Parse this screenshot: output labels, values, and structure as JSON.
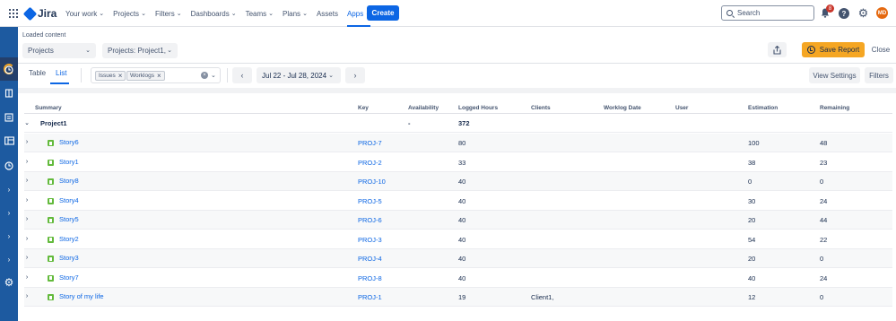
{
  "topnav": {
    "logo_text": "Jira",
    "items": [
      {
        "label": "Your work",
        "chevron": true,
        "active": false
      },
      {
        "label": "Projects",
        "chevron": true,
        "active": false
      },
      {
        "label": "Filters",
        "chevron": true,
        "active": false
      },
      {
        "label": "Dashboards",
        "chevron": true,
        "active": false
      },
      {
        "label": "Teams",
        "chevron": true,
        "active": false
      },
      {
        "label": "Plans",
        "chevron": true,
        "active": false
      },
      {
        "label": "Assets",
        "chevron": false,
        "active": false
      },
      {
        "label": "Apps",
        "chevron": true,
        "active": true
      }
    ],
    "create_label": "Create",
    "search_placeholder": "Search",
    "notification_count": "8",
    "help_label": "?",
    "avatar_initials": "MD"
  },
  "sidebar": {
    "icons": [
      "app-logo-icon",
      "clock-icon",
      "book-icon",
      "list-icon",
      "board-icon",
      "history-icon",
      "chevron-right-icon",
      "chevron-right-icon",
      "chevron-right-icon",
      "chevron-right-icon",
      "gear-icon"
    ]
  },
  "header": {
    "loaded_text": "Loaded content",
    "projects_select": "Projects",
    "projects_filter": "Projects: Project1,",
    "save_report_label": "Save Report",
    "close_label": "Close"
  },
  "toolbar": {
    "tabs": [
      "Table",
      "List"
    ],
    "active_tab": "List",
    "filter_tags": [
      "Issues",
      "Worklogs"
    ],
    "date_range": "Jul 22 - Jul 28, 2024",
    "view_settings_label": "View Settings",
    "filters_label": "Filters"
  },
  "table": {
    "columns": [
      "Summary",
      "Key",
      "Availability",
      "Logged Hours",
      "Clients",
      "Worklog Date",
      "User",
      "Estimation",
      "Remaining"
    ],
    "group": {
      "name": "Project1",
      "availability": "-",
      "logged_hours": "372"
    },
    "rows": [
      {
        "summary": "Story6",
        "key": "PROJ-7",
        "logged": "80",
        "clients": "",
        "estimation": "100",
        "remaining": "48"
      },
      {
        "summary": "Story1",
        "key": "PROJ-2",
        "logged": "33",
        "clients": "",
        "estimation": "38",
        "remaining": "23"
      },
      {
        "summary": "Story8",
        "key": "PROJ-10",
        "logged": "40",
        "clients": "",
        "estimation": "0",
        "remaining": "0"
      },
      {
        "summary": "Story4",
        "key": "PROJ-5",
        "logged": "40",
        "clients": "",
        "estimation": "30",
        "remaining": "24"
      },
      {
        "summary": "Story5",
        "key": "PROJ-6",
        "logged": "40",
        "clients": "",
        "estimation": "20",
        "remaining": "44"
      },
      {
        "summary": "Story2",
        "key": "PROJ-3",
        "logged": "40",
        "clients": "",
        "estimation": "54",
        "remaining": "22"
      },
      {
        "summary": "Story3",
        "key": "PROJ-4",
        "logged": "40",
        "clients": "",
        "estimation": "20",
        "remaining": "0"
      },
      {
        "summary": "Story7",
        "key": "PROJ-8",
        "logged": "40",
        "clients": "",
        "estimation": "40",
        "remaining": "24"
      },
      {
        "summary": "Story of my life",
        "key": "PROJ-1",
        "logged": "19",
        "clients": "Client1,",
        "estimation": "12",
        "remaining": "0"
      }
    ]
  },
  "colors": {
    "accent": "#0c66e4",
    "sidebar": "#1d5aa0",
    "save_button": "#f5a623",
    "story_icon": "#63ba3c",
    "badge": "#c9372c"
  }
}
